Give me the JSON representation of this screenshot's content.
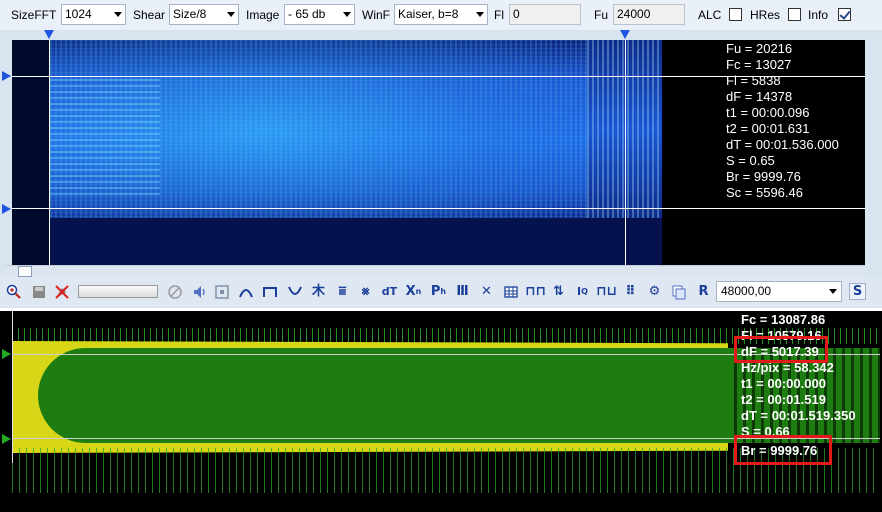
{
  "toolbar": {
    "sizefft_label": "SizeFFT",
    "sizefft_value": "1024",
    "shear_label": "Shear",
    "shear_value": "Size/8",
    "image_label": "Image",
    "image_value": "- 65 db",
    "winf_label": "WinF",
    "winf_value": "Kaiser, b=8",
    "fl_label": "Fl",
    "fl_value": "0",
    "fu_label": "Fu",
    "fu_value": "24000",
    "alc_label": "ALC",
    "alc_checked": false,
    "hres_label": "HRes",
    "hres_checked": false,
    "info_label": "Info",
    "info_checked": true
  },
  "spectrogram_info": [
    "Fu = 20216",
    "Fc = 13027",
    "Fl = 5838",
    "dF = 14378",
    "t1 = 00:00.096",
    "t2 = 00:01.631",
    "dT = 00:01.536.000",
    "S = 0.65",
    "Br = 9999.76",
    "Sc = 5596.46"
  ],
  "tools": {
    "frequency_value": "48000,00",
    "s_button": "S",
    "dt_label": "dT",
    "r_label": "R"
  },
  "spectrum_info": [
    "Fc = 13087.86",
    "Fl = 10579.16",
    "dF = 5017.39",
    "Hz/pix = 58.342",
    "t1 = 00:00.000",
    "t2 = 00:01.519",
    "dT = 00:01.519.350",
    "S = 0.66",
    "Br = 9999.76"
  ],
  "colors": {
    "highlight": "#e21a1a",
    "yellow_trace": "#d7d718",
    "green_trace": "#1e7d10",
    "marker": "#1f55e0"
  }
}
